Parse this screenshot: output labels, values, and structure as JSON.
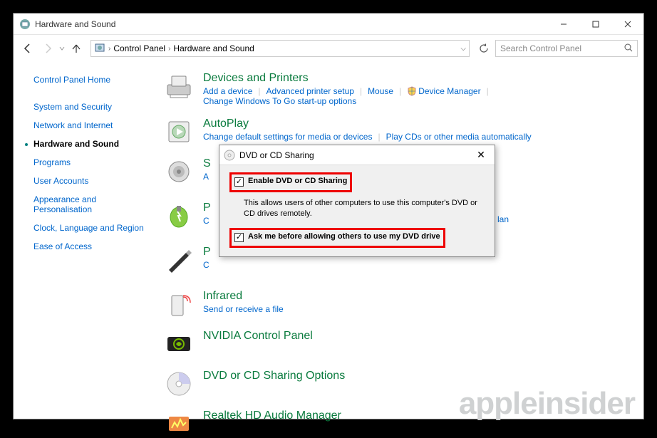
{
  "window_title": "Hardware and Sound",
  "breadcrumb": {
    "root": "Control Panel",
    "current": "Hardware and Sound"
  },
  "search_placeholder": "Search Control Panel",
  "sidebar": {
    "items": [
      {
        "label": "Control Panel Home",
        "active": false
      },
      {
        "label": "System and Security",
        "active": false
      },
      {
        "label": "Network and Internet",
        "active": false
      },
      {
        "label": "Hardware and Sound",
        "active": true
      },
      {
        "label": "Programs",
        "active": false
      },
      {
        "label": "User Accounts",
        "active": false
      },
      {
        "label": "Appearance and\nPersonalisation",
        "active": false
      },
      {
        "label": "Clock, Language and Region",
        "active": false
      },
      {
        "label": "Ease of Access",
        "active": false
      }
    ]
  },
  "categories": {
    "devices": {
      "title": "Devices and Printers",
      "links": [
        "Add a device",
        "Advanced printer setup",
        "Mouse",
        "Device Manager",
        "Change Windows To Go start-up options"
      ]
    },
    "autoplay": {
      "title": "AutoPlay",
      "links": [
        "Change default settings for media or devices",
        "Play CDs or other media automatically"
      ]
    },
    "sound": {
      "title_trunc": "S",
      "link_trunc": "A"
    },
    "power": {
      "title_trunc": "P",
      "link_trunc": "C",
      "lan_fragment": "lan"
    },
    "pen": {
      "title_trunc": "P",
      "link_trunc": "C"
    },
    "infrared": {
      "title": "Infrared",
      "links": [
        "Send or receive a file"
      ]
    },
    "nvidia": {
      "title": "NVIDIA Control Panel"
    },
    "dvd": {
      "title": "DVD or CD Sharing Options"
    },
    "realtek": {
      "title": "Realtek HD Audio Manager"
    }
  },
  "dialog": {
    "title": "DVD or CD Sharing",
    "option1": {
      "label": "Enable DVD or CD Sharing",
      "description": "This allows users of other computers to use this computer's DVD or CD drives remotely.",
      "checked": true
    },
    "option2": {
      "label": "Ask me before allowing others to use my DVD drive",
      "checked": true
    }
  },
  "watermark": "appleinsider"
}
